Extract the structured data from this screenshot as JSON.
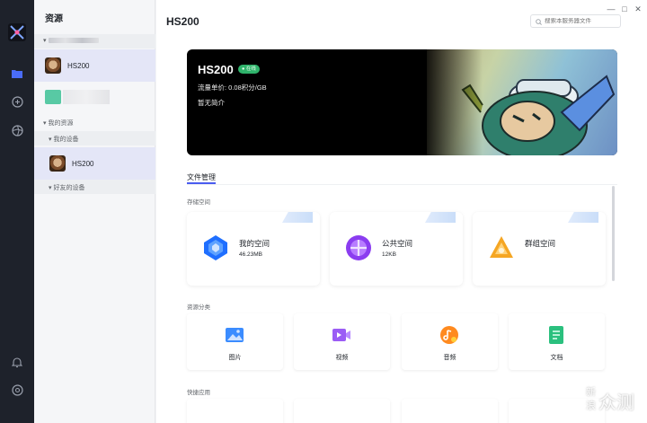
{
  "window": {
    "minimize": "—",
    "maximize": "□",
    "close": "✕"
  },
  "sidebar": {
    "title": "资源",
    "hosts": [
      {
        "label": "HS200",
        "selected": true
      }
    ],
    "my_resources_label": "我的资源",
    "my_devices_label": "我的设备",
    "devices": [
      {
        "label": "HS200",
        "selected": true
      }
    ],
    "friend_devices_label": "好友的设备"
  },
  "header": {
    "title": "HS200",
    "search_placeholder": "搜索本服务器文件"
  },
  "banner": {
    "name": "HS200",
    "status": "在线",
    "price": "流量单价: 0.08积分/GB",
    "description": "暂无简介",
    "status_color": "#2fb36b"
  },
  "tabs": [
    {
      "label": "文件管理",
      "active": true
    }
  ],
  "storage": {
    "section_label": "存储空间",
    "cards": [
      {
        "title": "我的空间",
        "size": "46.23MB",
        "icon": "my-space-icon",
        "color": "#1f6fff"
      },
      {
        "title": "公共空间",
        "size": "12KB",
        "icon": "public-space-icon",
        "color": "#8b3df0"
      },
      {
        "title": "群组空间",
        "size": "",
        "icon": "group-space-icon",
        "color": "#f5a623"
      }
    ]
  },
  "categories": {
    "section_label": "资源分类",
    "items": [
      {
        "label": "图片",
        "icon": "image-icon",
        "color": "#3b8cff"
      },
      {
        "label": "视频",
        "icon": "video-icon",
        "color": "#9b5cf5"
      },
      {
        "label": "音频",
        "icon": "audio-icon",
        "color": "#ff8a1f"
      },
      {
        "label": "文档",
        "icon": "document-icon",
        "color": "#2bc07e"
      }
    ]
  },
  "quick_apps": {
    "section_label": "快捷应用"
  },
  "watermark": {
    "line1": "新",
    "line2": "浪",
    "brand": "众测"
  }
}
